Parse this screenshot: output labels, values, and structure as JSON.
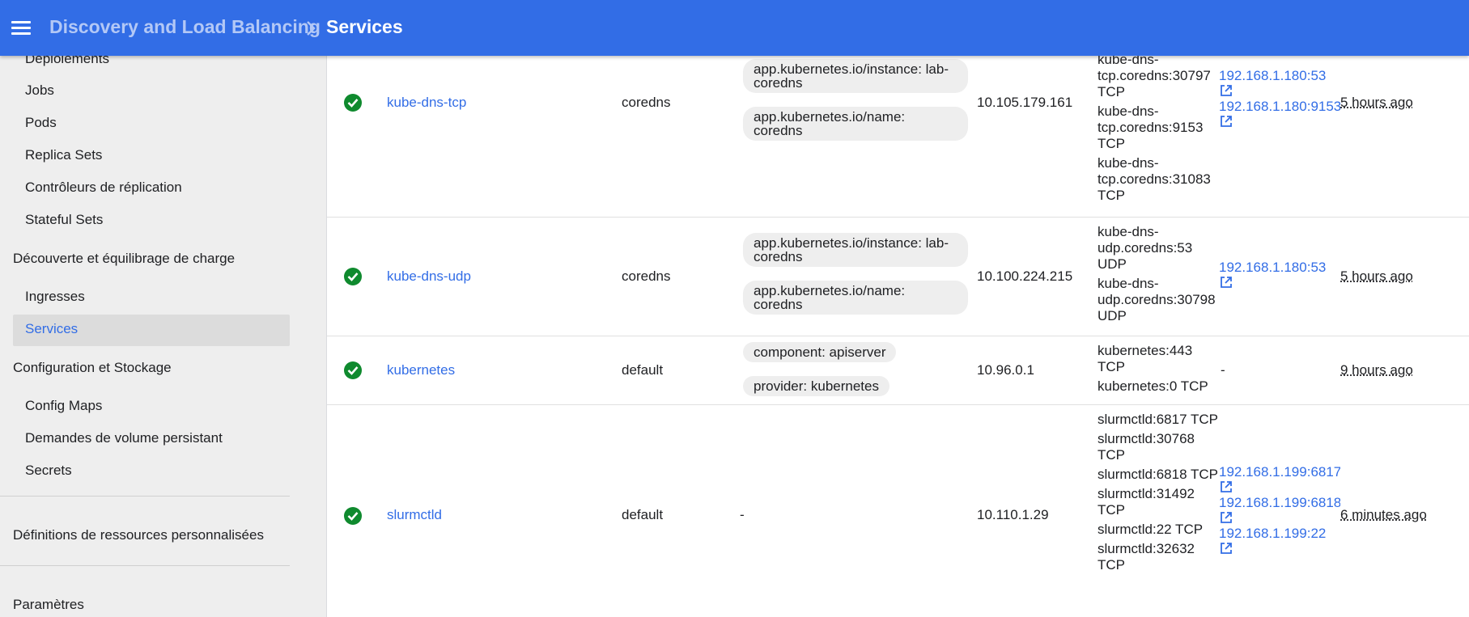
{
  "header": {
    "parent": "Discovery and Load Balancing",
    "current": "Services",
    "menu_icon": "hamburger-menu-icon",
    "separator_icon": "chevron-right-icon",
    "bar_color": "#326de6"
  },
  "sidebar": {
    "items": [
      {
        "label": "Déploiements",
        "kind": "sub"
      },
      {
        "label": "Jobs",
        "kind": "sub"
      },
      {
        "label": "Pods",
        "kind": "sub"
      },
      {
        "label": "Replica Sets",
        "kind": "sub"
      },
      {
        "label": "Contrôleurs de réplication",
        "kind": "sub"
      },
      {
        "label": "Stateful Sets",
        "kind": "sub"
      },
      {
        "label": "Découverte et équilibrage de charge",
        "kind": "category"
      },
      {
        "label": "Ingresses",
        "kind": "sub"
      },
      {
        "label": "Services",
        "kind": "sub",
        "active": true
      },
      {
        "label": "Configuration et Stockage",
        "kind": "category"
      },
      {
        "label": "Config Maps",
        "kind": "sub"
      },
      {
        "label": "Demandes de volume persistant",
        "kind": "sub"
      },
      {
        "label": "Secrets",
        "kind": "sub"
      },
      {
        "label": "Définitions de ressources personnalisées",
        "kind": "category"
      },
      {
        "label": "Paramètres",
        "kind": "category"
      }
    ]
  },
  "rows": [
    {
      "status_icon": "check-circle-icon",
      "name": "kube-dns-tcp",
      "namespace": "coredns",
      "labels": [
        "app.kubernetes.io/instance: lab-coredns",
        "app.kubernetes.io/name: coredns"
      ],
      "cluster_ip": "10.105.179.161",
      "internal_endpoints": [
        "kube-dns-tcp.coredns:30797 TCP",
        "kube-dns-tcp.coredns:9153 TCP",
        "kube-dns-tcp.coredns:31083 TCP"
      ],
      "external_endpoints": [
        "192.168.1.180:53",
        "192.168.1.180:9153"
      ],
      "age": "5 hours ago"
    },
    {
      "status_icon": "check-circle-icon",
      "name": "kube-dns-udp",
      "namespace": "coredns",
      "labels": [
        "app.kubernetes.io/instance: lab-coredns",
        "app.kubernetes.io/name: coredns"
      ],
      "cluster_ip": "10.100.224.215",
      "internal_endpoints": [
        "kube-dns-udp.coredns:53 UDP",
        "kube-dns-udp.coredns:30798 UDP"
      ],
      "external_endpoints": [
        "192.168.1.180:53"
      ],
      "age": "5 hours ago"
    },
    {
      "status_icon": "check-circle-icon",
      "name": "kubernetes",
      "namespace": "default",
      "labels": [
        "component: apiserver",
        "provider: kubernetes"
      ],
      "cluster_ip": "10.96.0.1",
      "internal_endpoints": [
        "kubernetes:443 TCP",
        "kubernetes:0 TCP"
      ],
      "external_endpoints_text": "-",
      "age": "9 hours ago"
    },
    {
      "status_icon": "check-circle-icon",
      "name": "slurmctld",
      "namespace": "default",
      "labels_text": "-",
      "cluster_ip": "10.110.1.29",
      "internal_endpoints": [
        "slurmctld:6817 TCP",
        "slurmctld:30768 TCP",
        "slurmctld:6818 TCP",
        "slurmctld:31492 TCP",
        "slurmctld:22 TCP",
        "slurmctld:32632 TCP"
      ],
      "external_endpoints": [
        "192.168.1.199:6817",
        "192.168.1.199:6818",
        "192.168.1.199:22"
      ],
      "age": "6 minutes ago"
    }
  ],
  "colors": {
    "link": "#326de6",
    "status_ok": "#0f8a2e",
    "chip": "#eeeeee",
    "sidebar": "#eeeeee"
  }
}
